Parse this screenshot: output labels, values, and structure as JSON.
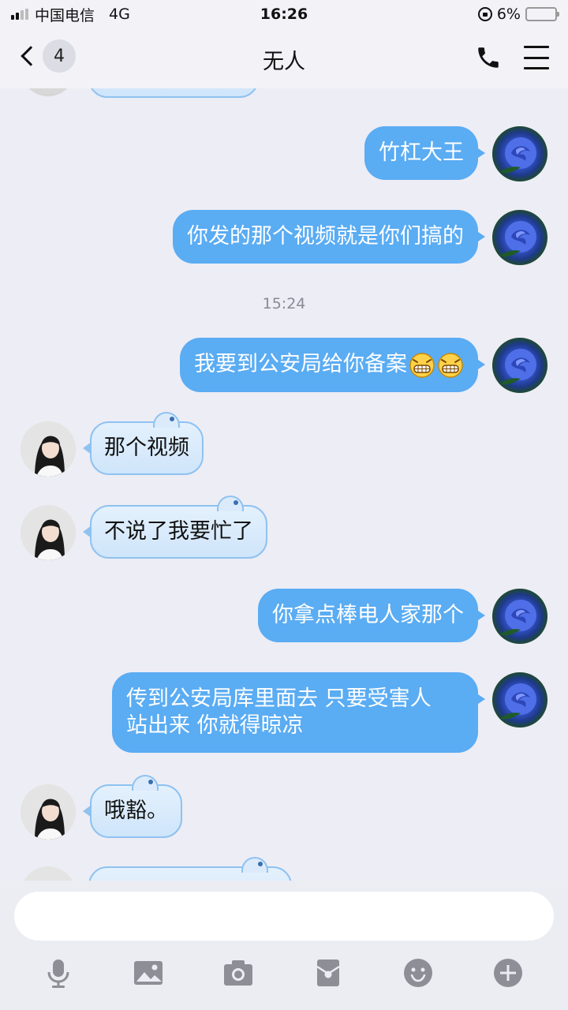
{
  "status_bar": {
    "carrier": "中国电信",
    "network": "4G",
    "time": "16:26",
    "battery_percent_label": "6%",
    "battery_level": 0.06
  },
  "nav": {
    "unread_count": "4",
    "title": "无人"
  },
  "messages": [
    {
      "side": "right",
      "text": "竹杠大王"
    },
    {
      "side": "right",
      "text": "你发的那个视频就是你们搞的"
    },
    {
      "type": "timestamp",
      "text": "15:24"
    },
    {
      "side": "right",
      "text": "我要到公安局给你备案"
    },
    {
      "side": "left",
      "text": "那个视频"
    },
    {
      "side": "left",
      "text": "不说了我要忙了"
    },
    {
      "side": "right",
      "text": "你拿点棒电人家那个"
    },
    {
      "side": "right",
      "text": "传到公安局库里面去 只要受害人",
      "text_line2": "站出来 你就得晾凉"
    },
    {
      "side": "left",
      "text": "哦豁。"
    }
  ],
  "input": {
    "placeholder": ""
  },
  "toolbar": {
    "items": [
      "microphone-icon",
      "image-icon",
      "camera-icon",
      "red-packet-icon",
      "emoji-icon",
      "plus-icon"
    ]
  },
  "colors": {
    "outgoing_bubble": "#5aacf3",
    "incoming_bubble": "#d8eafc",
    "background": "#ededf5",
    "battery_low": "#e23a3a"
  }
}
